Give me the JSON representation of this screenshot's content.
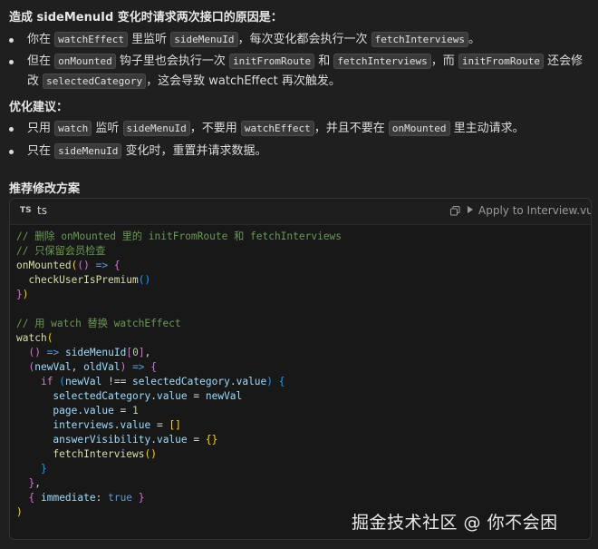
{
  "intro": "造成 sideMenuId 变化时请求两次接口的原因是：",
  "reasons": [
    {
      "parts": [
        "你在 ",
        {
          "code": "watchEffect"
        },
        " 里监听 ",
        {
          "code": "sideMenuId"
        },
        "，每次变化都会执行一次 ",
        {
          "code": "fetchInterviews"
        },
        "。"
      ]
    },
    {
      "parts": [
        "但在 ",
        {
          "code": "onMounted"
        },
        " 钩子里也会执行一次 ",
        {
          "code": "initFromRoute"
        },
        " 和 ",
        {
          "code": "fetchInterviews"
        },
        "，而 ",
        {
          "code": "initFromRoute"
        },
        " 还会修改 ",
        {
          "code": "selectedCategory"
        },
        "，这会导致 watchEffect 再次触发。"
      ]
    }
  ],
  "suggestion_title": "优化建议：",
  "suggestions": [
    {
      "parts": [
        "只用 ",
        {
          "code": "watch"
        },
        " 监听 ",
        {
          "code": "sideMenuId"
        },
        "，不要用 ",
        {
          "code": "watchEffect"
        },
        "，并且不要在 ",
        {
          "code": "onMounted"
        },
        " 里主动请求。"
      ]
    },
    {
      "parts": [
        "只在 ",
        {
          "code": "sideMenuId"
        },
        " 变化时，重置并请求数据。"
      ]
    }
  ],
  "plan_title": "推荐修改方案",
  "code_block": {
    "lang_badge": "TS",
    "lang": "ts",
    "apply_label": "Apply to Interview.vu..."
  },
  "watermark": "掘金技术社区 @ 你不会困"
}
